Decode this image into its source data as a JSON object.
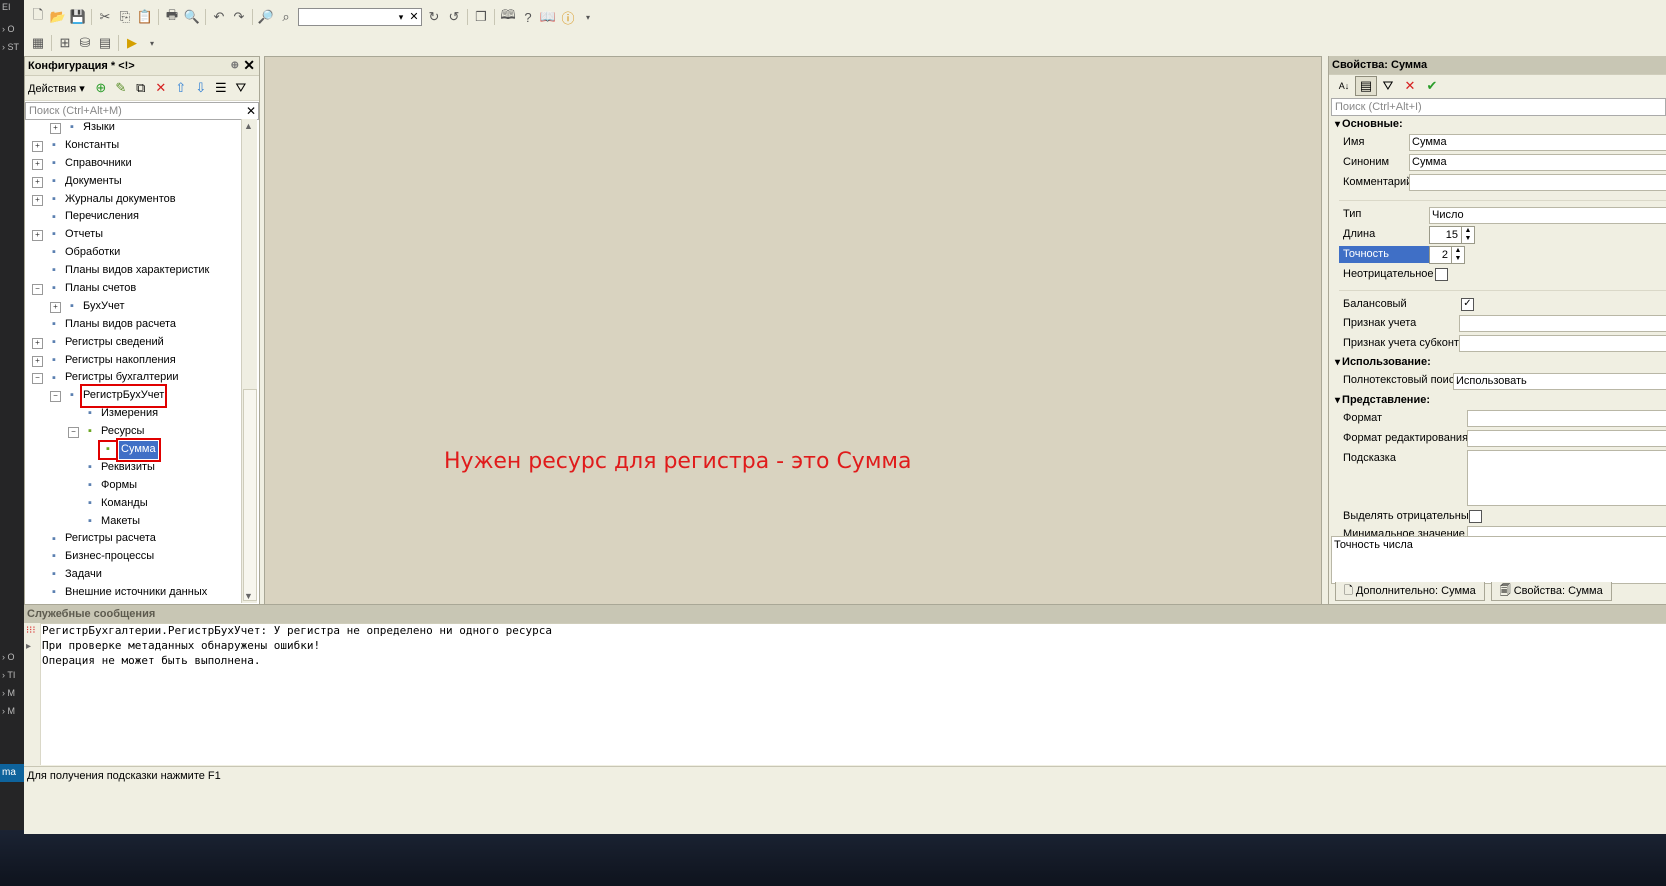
{
  "toolbar": {
    "search_value": ""
  },
  "left_panel": {
    "title": "Конфигурация * <!>",
    "actions_label": "Действия",
    "search_placeholder": "Поиск (Ctrl+Alt+M)",
    "tree": [
      {
        "label": "Языки",
        "level": 1,
        "expand": "+",
        "icon": "languages-icon"
      },
      {
        "label": "Константы",
        "level": 0,
        "expand": "+",
        "icon": "constants-icon"
      },
      {
        "label": "Справочники",
        "level": 0,
        "expand": "+",
        "icon": "catalogs-icon"
      },
      {
        "label": "Документы",
        "level": 0,
        "expand": "+",
        "icon": "documents-icon"
      },
      {
        "label": "Журналы документов",
        "level": 0,
        "expand": "+",
        "icon": "journals-icon"
      },
      {
        "label": "Перечисления",
        "level": 0,
        "expand": "",
        "icon": "enums-icon"
      },
      {
        "label": "Отчеты",
        "level": 0,
        "expand": "+",
        "icon": "reports-icon"
      },
      {
        "label": "Обработки",
        "level": 0,
        "expand": "",
        "icon": "processing-icon"
      },
      {
        "label": "Планы видов характеристик",
        "level": 0,
        "expand": "",
        "icon": "charts-of-characteristics-icon"
      },
      {
        "label": "Планы счетов",
        "level": 0,
        "expand": "−",
        "icon": "charts-of-accounts-icon"
      },
      {
        "label": "БухУчет",
        "level": 1,
        "expand": "+",
        "icon": "account-plan-icon"
      },
      {
        "label": "Планы видов расчета",
        "level": 0,
        "expand": "",
        "icon": "calculation-types-icon"
      },
      {
        "label": "Регистры сведений",
        "level": 0,
        "expand": "+",
        "icon": "info-registers-icon"
      },
      {
        "label": "Регистры накопления",
        "level": 0,
        "expand": "+",
        "icon": "accumulation-registers-icon"
      },
      {
        "label": "Регистры бухгалтерии",
        "level": 0,
        "expand": "−",
        "icon": "accounting-registers-icon"
      },
      {
        "label": "РегистрБухУчет",
        "level": 1,
        "expand": "−",
        "icon": "register-icon",
        "highlight": true
      },
      {
        "label": "Измерения",
        "level": 2,
        "expand": "",
        "icon": "dimensions-icon"
      },
      {
        "label": "Ресурсы",
        "level": 2,
        "expand": "−",
        "icon": "resources-icon"
      },
      {
        "label": "Сумма",
        "level": 3,
        "expand": "",
        "icon": "resource-item-icon",
        "highlight": true,
        "selected": true
      },
      {
        "label": "Реквизиты",
        "level": 2,
        "expand": "",
        "icon": "attributes-icon"
      },
      {
        "label": "Формы",
        "level": 2,
        "expand": "",
        "icon": "forms-icon"
      },
      {
        "label": "Команды",
        "level": 2,
        "expand": "",
        "icon": "commands-icon"
      },
      {
        "label": "Макеты",
        "level": 2,
        "expand": "",
        "icon": "templates-icon"
      },
      {
        "label": "Регистры расчета",
        "level": 0,
        "expand": "",
        "icon": "calc-registers-icon"
      },
      {
        "label": "Бизнес-процессы",
        "level": 0,
        "expand": "",
        "icon": "business-processes-icon"
      },
      {
        "label": "Задачи",
        "level": 0,
        "expand": "",
        "icon": "tasks-icon"
      },
      {
        "label": "Внешние источники данных",
        "level": 0,
        "expand": "",
        "icon": "external-sources-icon"
      }
    ]
  },
  "workspace": {
    "annotation": "Нужен ресурс для регистра - это Сумма",
    "annotation_color": "#e01b1b"
  },
  "right_panel": {
    "title": "Свойства: Сумма",
    "search_placeholder": "Поиск (Ctrl+Alt+I)",
    "groups": {
      "main": "Основные:",
      "usage": "Использование:",
      "presentation": "Представление:"
    },
    "labels": {
      "name": "Имя",
      "synonym": "Синоним",
      "comment": "Комментарий",
      "type": "Тип",
      "length": "Длина",
      "precision": "Точность",
      "nonnegative": "Неотрицательное",
      "balance": "Балансовый",
      "accounting_flag": "Признак учета",
      "subconto_flag": "Признак учета субконто",
      "fulltext": "Полнотекстовый поиск",
      "format": "Формат",
      "edit_format": "Формат редактирования",
      "tooltip": "Подсказка",
      "mark_negative": "Выделять отрицательные",
      "min_value": "Минимальное значение"
    },
    "values": {
      "name": "Сумма",
      "synonym": "Сумма",
      "comment": "",
      "type": "Число",
      "length": "15",
      "precision": "2",
      "fulltext": "Использовать"
    },
    "hint_text": "Точность числа",
    "tabs": [
      "Дополнительно: Сумма",
      "Свойства: Сумма"
    ]
  },
  "messages": {
    "title": "Служебные сообщения",
    "lines": [
      "РегистрБухгалтерии.РегистрБухУчет: У регистра не определено ни одного ресурса",
      "При проверке метаданных обнаружены ошибки!",
      "Операция не может быть выполнена."
    ]
  },
  "status_bar": "Для получения подсказки нажмите F1"
}
